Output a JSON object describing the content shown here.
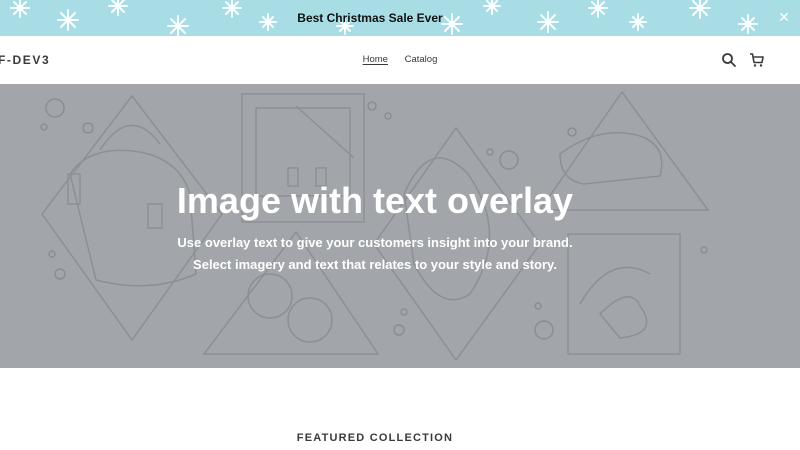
{
  "announcement": {
    "text": "Best Christmas Sale Ever",
    "close_icon": "close-icon",
    "background": "#a8dde6"
  },
  "header": {
    "logo": "F-DEV3",
    "nav": [
      {
        "label": "Home",
        "active": true
      },
      {
        "label": "Catalog",
        "active": false
      }
    ],
    "search_icon": "search-icon",
    "cart_icon": "cart-icon"
  },
  "hero": {
    "title": "Image with text overlay",
    "subtitle_line1": "Use overlay text to give your customers insight into your brand.",
    "subtitle_line2": "Select imagery and text that relates to your style and story.",
    "background": "#a2a6aa"
  },
  "featured": {
    "heading": "FEATURED COLLECTION"
  }
}
